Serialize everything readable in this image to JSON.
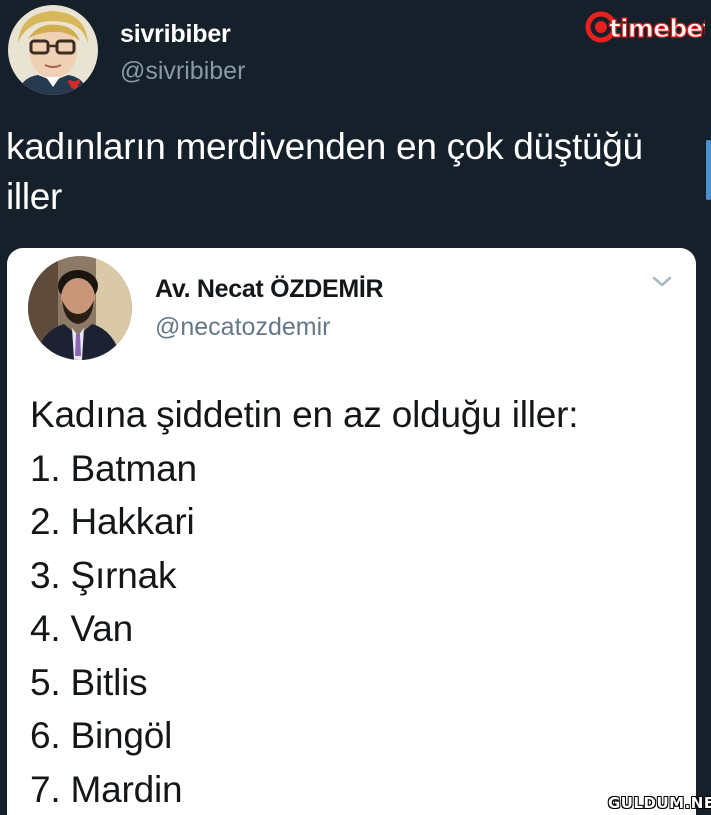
{
  "tweet": {
    "display_name": "sivribiber",
    "handle": "@sivribiber",
    "text": "kadınların merdivenden en çok düştüğü iller"
  },
  "quoted_tweet": {
    "display_name": "Av. Necat ÖZDEMİR",
    "handle": "@necatozdemir",
    "lines": [
      "Kadına şiddetin en az olduğu iller:",
      "1. Batman",
      "2. Hakkari",
      "3. Şırnak",
      "4. Van",
      "5. Bitlis",
      "6. Bingöl",
      "7. Mardin"
    ]
  },
  "logo": {
    "text": "timebet"
  },
  "watermark": {
    "text": "GULDUM.NET"
  },
  "icons": {
    "menu": "chevron-down-icon"
  },
  "colors": {
    "background": "#15202b",
    "card": "#ffffff",
    "secondary_text": "#8899a6",
    "logo_red": "#e8211c"
  }
}
